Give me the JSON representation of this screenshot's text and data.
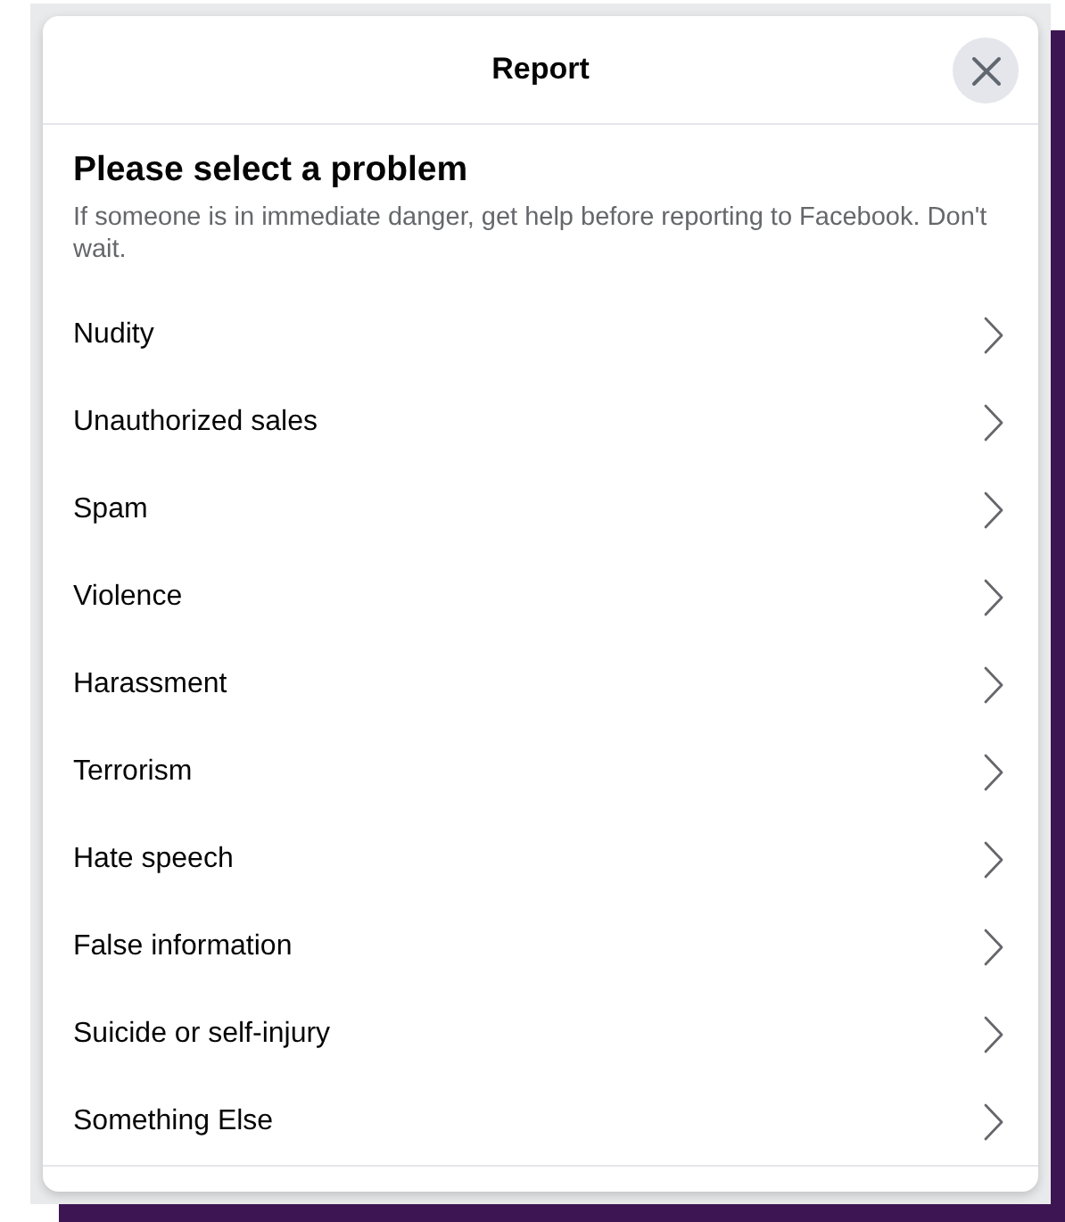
{
  "dialog": {
    "title": "Report",
    "heading": "Please select a problem",
    "description": "If someone is in immediate danger, get help before reporting to Facebook. Don't wait.",
    "options": [
      {
        "label": "Nudity"
      },
      {
        "label": "Unauthorized sales"
      },
      {
        "label": "Spam"
      },
      {
        "label": "Violence"
      },
      {
        "label": "Harassment"
      },
      {
        "label": "Terrorism"
      },
      {
        "label": "Hate speech"
      },
      {
        "label": "False information"
      },
      {
        "label": "Suicide or self-injury"
      },
      {
        "label": "Something Else"
      }
    ]
  }
}
